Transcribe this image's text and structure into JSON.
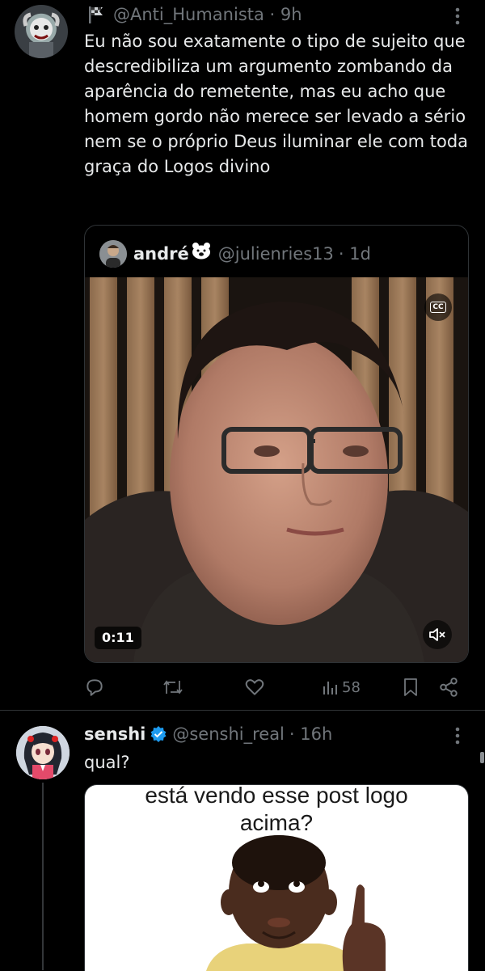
{
  "tweet1": {
    "handle": "@Anti_Humanista",
    "time": "· 9h",
    "text": "Eu não sou exatamente o tipo de sujeito que descredibiliza um argumento zombando da aparência do remetente, mas eu acho que homem gordo não merece ser levado a sério nem se o próprio Deus iluminar ele com toda graça do Logos divino",
    "quote": {
      "name": "andré",
      "handle": "@julienries13",
      "time": "· 1d",
      "video": {
        "duration": "0:11",
        "cc_label": "CC"
      }
    },
    "stats": {
      "views": "58"
    }
  },
  "tweet2": {
    "name": "senshi",
    "handle": "@senshi_real",
    "time": "· 16h",
    "text": "qual?",
    "meme_caption": "está vendo esse post logo acima?"
  },
  "icons": {
    "flag": "flag-icon",
    "more": "more-icon",
    "reply": "reply-icon",
    "retweet": "retweet-icon",
    "like": "like-icon",
    "views": "views-icon",
    "bookmark": "bookmark-icon",
    "share": "share-icon",
    "verified": "verified-badge-icon",
    "mute": "mute-icon",
    "polar_bear": "polar-bear-emoji-icon"
  },
  "colors": {
    "accent": "#1d9bf0",
    "muted": "#71767b",
    "background": "#000000"
  }
}
